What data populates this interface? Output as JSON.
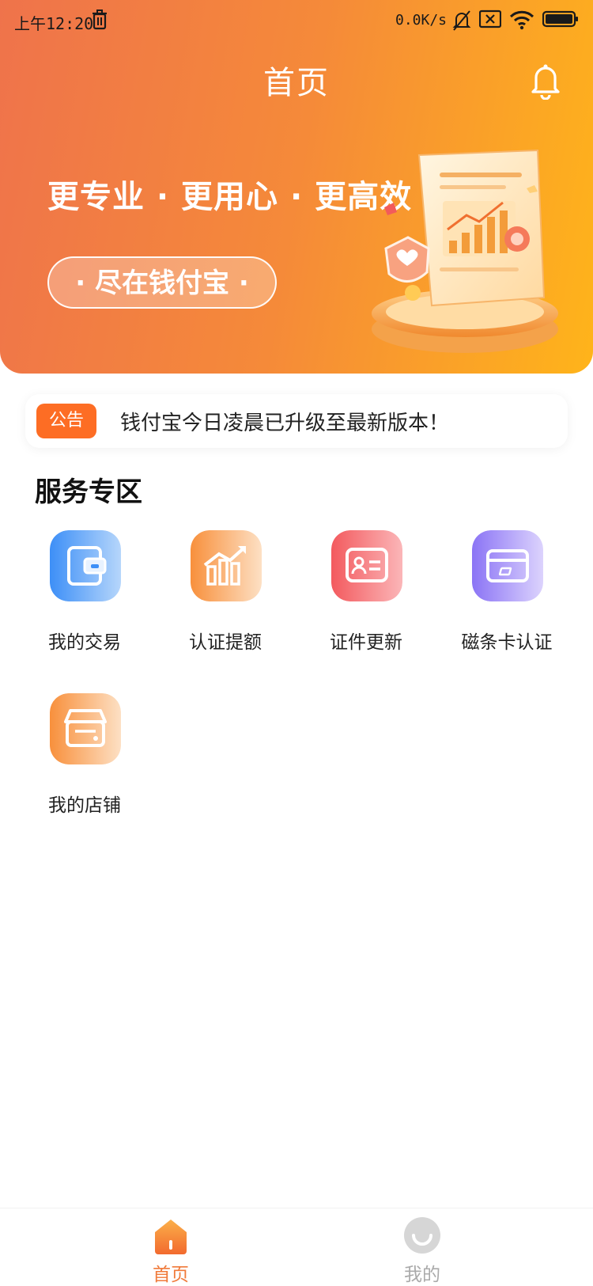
{
  "status_bar": {
    "time": "上午12:20",
    "net_speed": "0.0K/s"
  },
  "header": {
    "title": "首页"
  },
  "banner": {
    "slogan": "更专业 · 更用心 · 更高效",
    "pill_text": "· 尽在钱付宝 ·"
  },
  "notice": {
    "tag": "公告",
    "text": "钱付宝今日凌晨已升级至最新版本！"
  },
  "services": {
    "title": "服务专区",
    "items": [
      {
        "label": "我的交易",
        "icon": "wallet-icon",
        "color": "#4a9bf8"
      },
      {
        "label": "认证提额",
        "icon": "chart-up-icon",
        "color": "#f89a4a"
      },
      {
        "label": "证件更新",
        "icon": "id-card-icon",
        "color": "#f56569"
      },
      {
        "label": "磁条卡认证",
        "icon": "card-icon",
        "color": "#9a83f7"
      },
      {
        "label": "我的店铺",
        "icon": "store-icon",
        "color": "#f8964a"
      }
    ]
  },
  "tabbar": {
    "home_label": "首页",
    "mine_label": "我的",
    "active_color": "#f07a3a",
    "inactive_color": "#aaaaaa"
  }
}
